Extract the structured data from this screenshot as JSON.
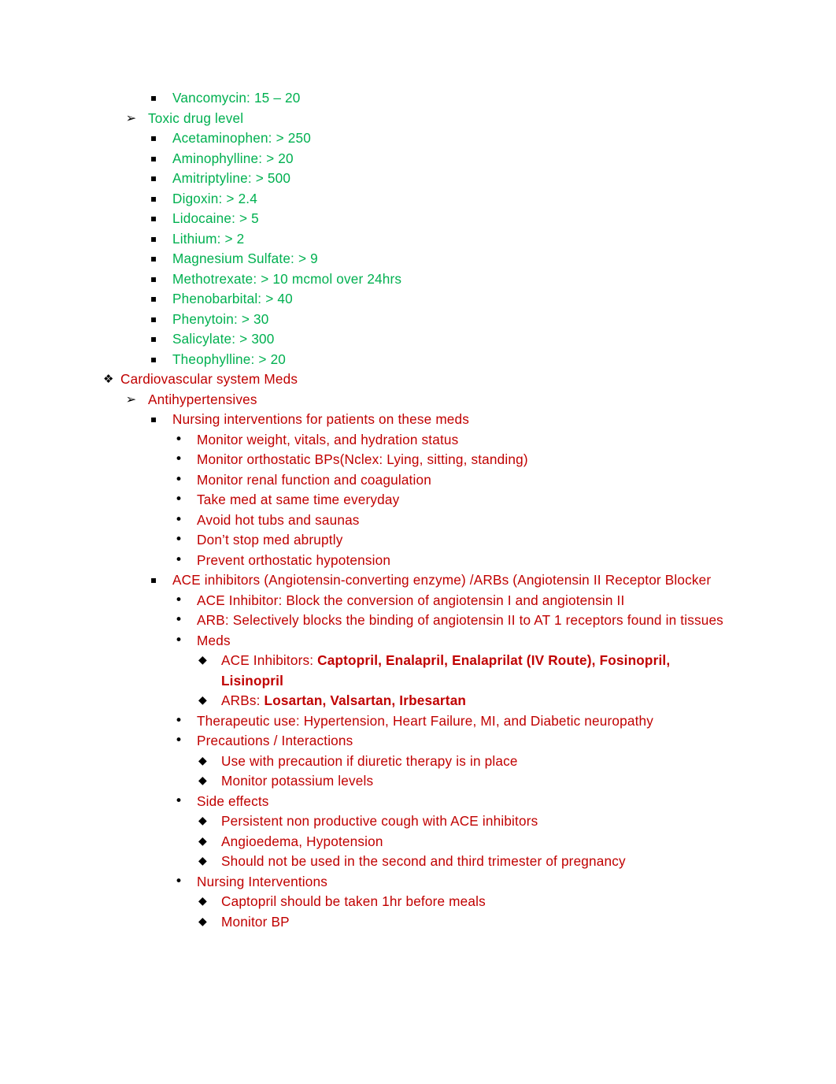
{
  "document": {
    "colors": {
      "green": "#00B050",
      "red": "#C00000",
      "bullet": "#000000",
      "background": "#FFFFFF"
    },
    "bullets": {
      "level1": "❖",
      "level2": "➢",
      "level3": "▪",
      "level4": "•",
      "level5": "◆"
    }
  },
  "outline": {
    "vancomycin": "Vancomycin: 15 – 20",
    "toxic_drug_level": "Toxic drug level",
    "toxic_levels": [
      "Acetaminophen: > 250",
      "Aminophylline: > 20",
      "Amitriptyline: > 500",
      "Digoxin: > 2.4",
      "Lidocaine: > 5",
      "Lithium: > 2",
      "Magnesium Sulfate: > 9",
      "Methotrexate: > 10 mcmol over 24hrs",
      "Phenobarbital: > 40",
      "Phenytoin: > 30",
      "Salicylate: > 300",
      "Theophylline: > 20"
    ],
    "cardiovascular_heading": "Cardiovascular system Meds",
    "antihypertensives_heading": "Antihypertensives",
    "nursing_interventions_heading": "Nursing interventions for patients on these meds",
    "nursing_interventions": [
      "Monitor weight, vitals, and hydration status",
      "Monitor orthostatic BPs(Nclex: Lying, sitting, standing)",
      "Monitor renal function and coagulation",
      "Take med at same time everyday",
      "Avoid hot tubs and saunas",
      "Don’t stop med abruptly",
      "Prevent orthostatic hypotension"
    ],
    "ace_arb_heading": "ACE inhibitors (Angiotensin-converting enzyme) /ARBs (Angiotensin II Receptor Blocker",
    "ace_inhibitor_definition": "ACE Inhibitor: Block the conversion of angiotensin I and angiotensin II",
    "arb_definition": "ARB: Selectively blocks the binding of angiotensin II to AT 1 receptors found in tissues",
    "meds_heading": "Meds",
    "ace_inhibitors_label": "ACE Inhibitors: ",
    "ace_inhibitors_drugs": "Captopril, Enalapril, Enalaprilat (IV Route), Fosinopril, Lisinopril",
    "arbs_label": "ARBs: ",
    "arbs_drugs": "Losartan, Valsartan, Irbesartan",
    "therapeutic_use": "Therapeutic use: Hypertension, Heart Failure, MI, and Diabetic neuropathy",
    "precautions_heading": "Precautions / Interactions",
    "precautions": [
      "Use with precaution if diuretic therapy is in place",
      "Monitor potassium levels"
    ],
    "side_effects_heading": "Side effects",
    "side_effects": [
      "Persistent non productive cough with ACE inhibitors",
      "Angioedema, Hypotension",
      "Should not be used in the second and third trimester of pregnancy"
    ],
    "nursing_interventions_ace_heading": "Nursing Interventions",
    "nursing_interventions_ace": [
      "Captopril should be taken 1hr before meals",
      "Monitor BP"
    ]
  }
}
